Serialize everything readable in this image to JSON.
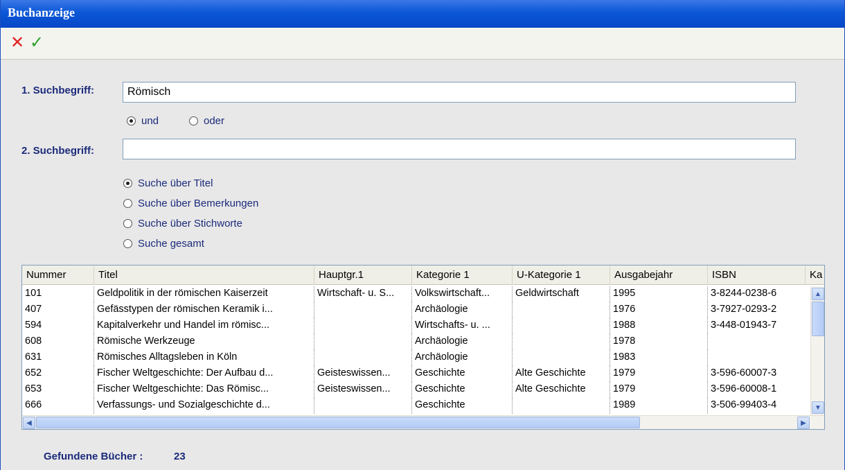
{
  "window": {
    "title": "Buchanzeige"
  },
  "toolbar": {
    "cancel_icon": "✕",
    "ok_icon": "✓"
  },
  "search": {
    "term1_label": "1. Suchbegriff:",
    "term1_value": "Römisch",
    "logic_options": [
      "und",
      "oder"
    ],
    "logic_selected": "und",
    "term2_label": "2. Suchbegriff:",
    "term2_value": "",
    "scope_options": [
      "Suche über Titel",
      "Suche über Bemerkungen",
      "Suche über Stichworte",
      "Suche gesamt"
    ],
    "scope_selected": "Suche über Titel"
  },
  "grid": {
    "columns": [
      "Nummer",
      "Titel",
      "Hauptgr.1",
      "Kategorie 1",
      "U-Kategorie 1",
      "Ausgabejahr",
      "ISBN",
      "Ka"
    ],
    "rows": [
      [
        "101",
        "Geldpolitik in der römischen Kaiserzeit",
        "Wirtschaft- u. S...",
        "Volkswirtschaft...",
        "Geldwirtschaft",
        "1995",
        "3-8244-0238-6"
      ],
      [
        "407",
        "Gefässtypen der römischen Keramik i...",
        "",
        "Archäologie",
        "",
        "1976",
        "3-7927-0293-2"
      ],
      [
        "594",
        "Kapitalverkehr und Handel im römisc...",
        "",
        "Wirtschafts- u. ...",
        "",
        "1988",
        "3-448-01943-7"
      ],
      [
        "608",
        "Römische Werkzeuge",
        "",
        "Archäologie",
        "",
        "1978",
        ""
      ],
      [
        "631",
        "Römisches Alltagsleben in Köln",
        "",
        "Archäologie",
        "",
        "1983",
        ""
      ],
      [
        "652",
        "Fischer Weltgeschichte: Der Aufbau d...",
        "Geisteswissen...",
        "Geschichte",
        "Alte Geschichte",
        "1979",
        "3-596-60007-3"
      ],
      [
        "653",
        "Fischer Weltgeschichte: Das Römisc...",
        "Geisteswissen...",
        "Geschichte",
        "Alte Geschichte",
        "1979",
        "3-596-60008-1"
      ],
      [
        "666",
        "Verfassungs- und Sozialgeschichte d...",
        "",
        "Geschichte",
        "",
        "1989",
        "3-506-99403-4"
      ]
    ]
  },
  "footer": {
    "found_label": "Gefundene Bücher :",
    "found_count": "23"
  }
}
